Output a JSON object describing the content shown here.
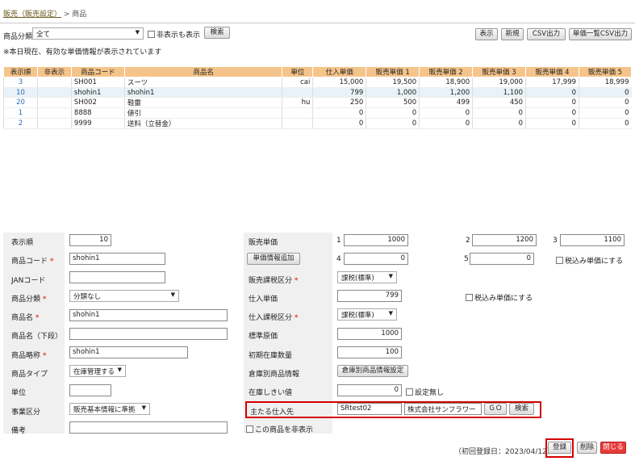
{
  "breadcrumb": {
    "parent": "販売（販売設定）",
    "sep": " > ",
    "current": "商品"
  },
  "filter": {
    "label": "商品分類",
    "value": "全て",
    "show_hidden": "非表示も表示",
    "search": "検索"
  },
  "toolbar": {
    "display": "表示",
    "new": "新規",
    "csv": "CSV出力",
    "price_csv": "単価一覧CSV出力"
  },
  "note": "※本日現在、有効な単価情報が表示されています",
  "table": {
    "headers": [
      "表示順",
      "非表示",
      "商品コード",
      "商品名",
      "単位",
      "仕入単価",
      "販売単価 1",
      "販売単価 2",
      "販売単価 3",
      "販売単価 4",
      "販売単価 5"
    ],
    "rows": [
      [
        "3",
        "",
        "SH001",
        "スーツ",
        "cai",
        "15,000",
        "19,500",
        "18,900",
        "19,000",
        "17,999",
        "18,999"
      ],
      [
        "10",
        "",
        "shohin1",
        "shohin1",
        "",
        "799",
        "1,000",
        "1,200",
        "1,100",
        "0",
        "0"
      ],
      [
        "20",
        "",
        "SH002",
        "鞋靈",
        "hu",
        "250",
        "500",
        "499",
        "450",
        "0",
        "0"
      ],
      [
        "1",
        "",
        "8888",
        "値引",
        "",
        "0",
        "0",
        "0",
        "0",
        "0",
        "0"
      ],
      [
        "2",
        "",
        "9999",
        "送料（立替金）",
        "",
        "0",
        "0",
        "0",
        "0",
        "0",
        "0"
      ]
    ]
  },
  "form": {
    "order_label": "表示順",
    "order": "10",
    "code_label": "商品コード",
    "code": "shohin1",
    "jan_label": "JANコード",
    "jan": "",
    "category_label": "商品分類",
    "category": "分類なし",
    "name_label": "商品名",
    "name": "shohin1",
    "name_lower_label": "商品名（下段）",
    "name_lower": "",
    "short_label": "商品略称",
    "short": "shohin1",
    "type_label": "商品タイプ",
    "type": "在庫管理する",
    "unit_label": "単位",
    "unit": "",
    "division_label": "事業区分",
    "division": "販売基本情報に準拠",
    "remarks_label": "備考",
    "remarks": "",
    "price_label": "販売単価",
    "price_nums": [
      "1",
      "2",
      "3",
      "4",
      "5"
    ],
    "prices": [
      "1000",
      "1200",
      "1100",
      "0",
      "0"
    ],
    "add_price": "単価情報追加",
    "tax_incl": "税込み単価にする",
    "sales_tax_label": "販売課税区分",
    "sales_tax": "課税(標準)",
    "cost_label": "仕入単価",
    "cost": "799",
    "cost_tax_incl": "税込み単価にする",
    "cost_tax_label": "仕入課税区分",
    "cost_tax": "課税(標準)",
    "std_cost_label": "標準原価",
    "std_cost": "1000",
    "init_stock_label": "初期在庫数量",
    "init_stock": "100",
    "wh_label": "倉庫別商品情報",
    "wh_btn": "倉庫別商品情報設定",
    "threshold_label": "在庫しきい値",
    "threshold": "0",
    "no_setting": "設定無し",
    "supplier_label": "主たる仕入先",
    "supplier_code": "SRtest02",
    "supplier_name": "株式会社サンフラワー",
    "go": "ＧＯ",
    "search": "検索",
    "hide_label": "この商品を非表示",
    "reg_date": "（初回登録日：2023/04/12）",
    "register": "登録",
    "delete": "削除",
    "close": "閉じる"
  }
}
